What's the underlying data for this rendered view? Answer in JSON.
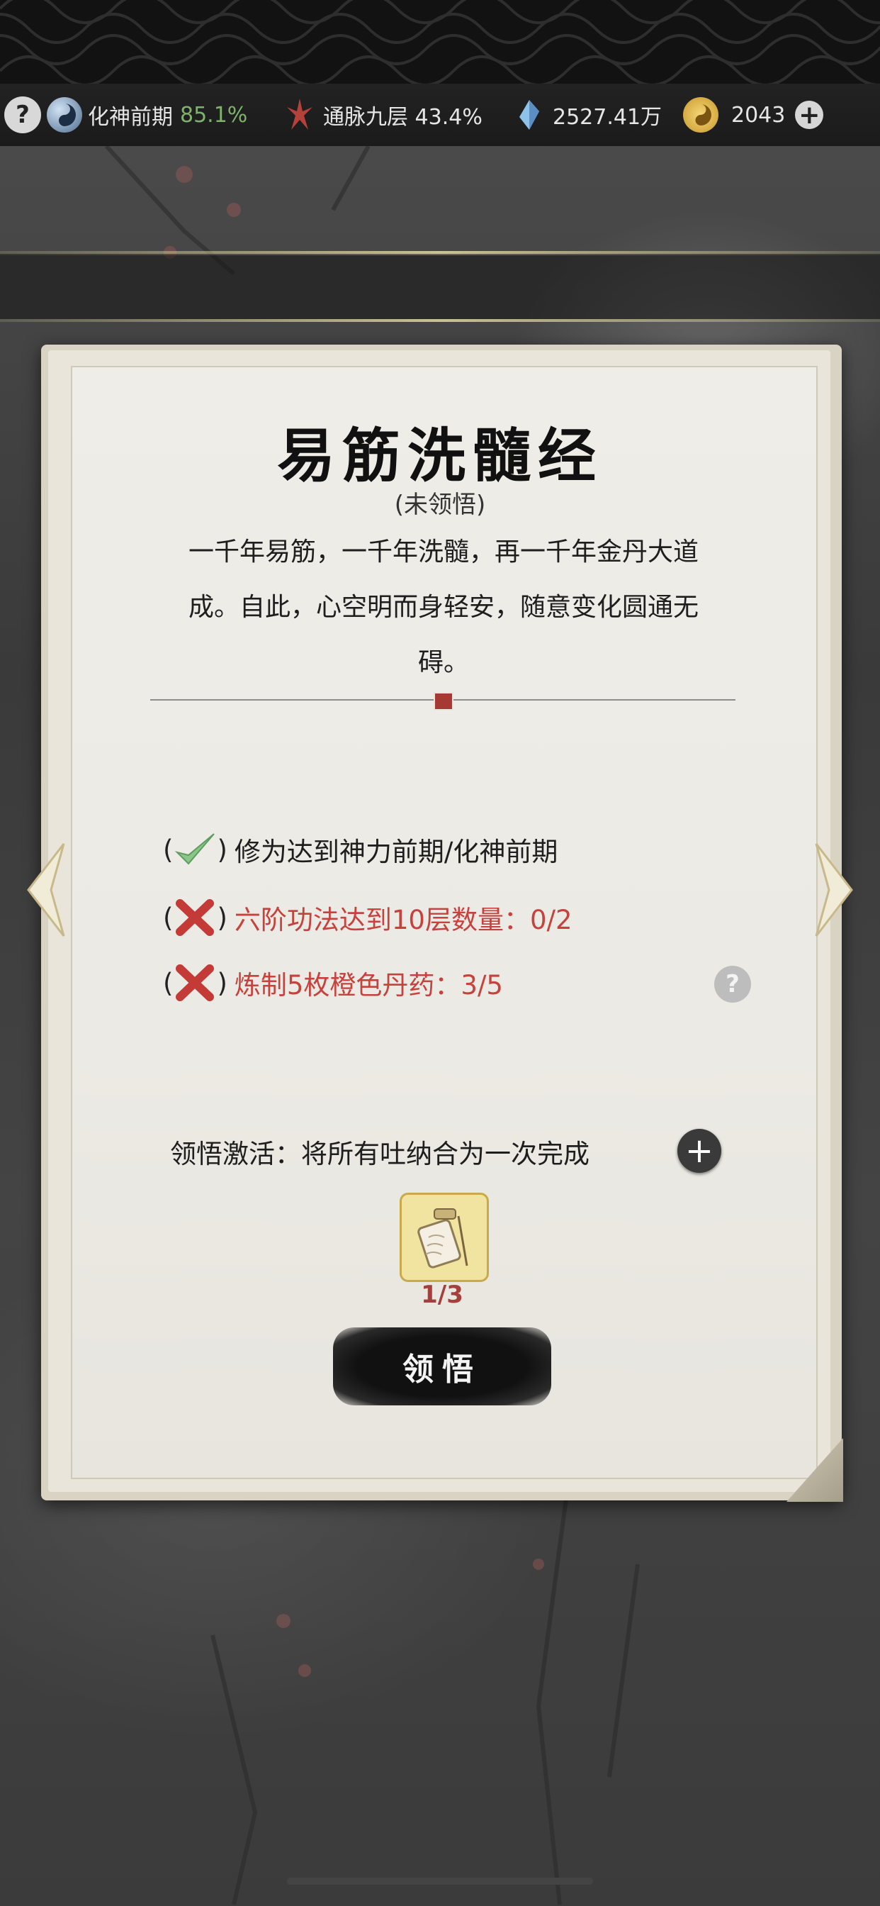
{
  "status_bar": {
    "realm_label": "化神前期",
    "realm_percent": "85.1%",
    "meridian_label": "通脉九层 43.4%",
    "spirit_stones": "2527.41万",
    "currency": "2043"
  },
  "card": {
    "title": "易筋洗髓经",
    "status": "(未领悟)",
    "description": "一千年易筋，一千年洗髓，再一千年金丹大道成。自此，心空明而身轻安，随意变化圆通无碍。"
  },
  "requirements": [
    {
      "text": "修为达到神力前期/化神前期",
      "met": true
    },
    {
      "text": "六阶功法达到10层数量：0/2",
      "met": false
    },
    {
      "text": "炼制5枚橙色丹药：3/5",
      "met": false
    }
  ],
  "activation": {
    "label": "领悟激活：将所有吐纳合为一次完成",
    "item_count": "1/3",
    "button_label": "领悟"
  },
  "colors": {
    "accent_green": "#7db36a",
    "fail_red": "#c7413d",
    "paper": "#eceae4"
  }
}
